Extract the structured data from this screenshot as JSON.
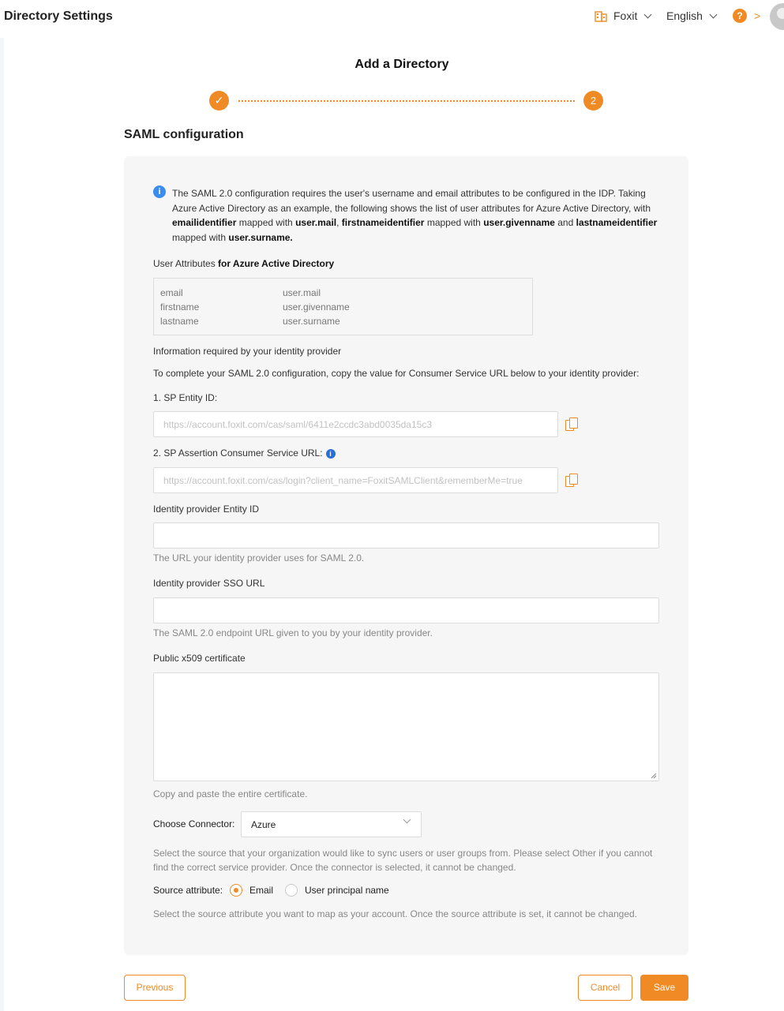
{
  "header": {
    "title": "Directory Settings",
    "org_name": "Foxit",
    "language": "English",
    "help_icon": "question-circle-icon",
    "help_label": "?",
    "arrow": ">"
  },
  "page": {
    "title": "Add a Directory",
    "steps": {
      "done_mark": "✓",
      "current": "2"
    },
    "section_title": "SAML configuration"
  },
  "info": {
    "icon_glyph": "i",
    "parts": [
      "The SAML 2.0 configuration requires the user's username and email attributes to be configured in the IDP. Taking Azure Active Directory as an example, the following shows the list of user attributes for Azure Active Directory, with ",
      "emailidentifier",
      " mapped with ",
      "user.mail",
      ", ",
      "firstnameidentifier",
      " mapped with ",
      "user.givenname",
      " and ",
      "lastnameidentifier",
      " mapped with ",
      "user.surname."
    ]
  },
  "attributes": {
    "heading_prefix": "User Attributes",
    "heading_bold": " for Azure Active Directory",
    "rows": [
      {
        "name": "email",
        "value": "user.mail"
      },
      {
        "name": "firstname",
        "value": "user.givenname"
      },
      {
        "name": "lastname",
        "value": "user.surname"
      }
    ]
  },
  "idp_info": {
    "heading": "Information required by your identity provider",
    "instruction": "To complete your SAML 2.0 configuration, copy the value for Consumer Service URL below to your identity provider:"
  },
  "sp_entity": {
    "label": "1. SP Entity ID:",
    "value": "https://account.foxit.com/cas/saml/6411e2ccdc3abd0035da15c3"
  },
  "sp_acs": {
    "label": "2. SP Assertion Consumer Service URL:",
    "info_glyph": "i",
    "value": "https://account.foxit.com/cas/login?client_name=FoxitSAMLClient&rememberMe=true"
  },
  "idp_entity": {
    "label": "Identity provider Entity ID",
    "value": "",
    "hint": "The URL your identity provider uses for SAML 2.0."
  },
  "idp_sso": {
    "label": "Identity provider SSO URL",
    "value": "",
    "hint": "The SAML 2.0 endpoint URL given to you by your identity provider."
  },
  "certificate": {
    "label": "Public x509 certificate",
    "value": "",
    "hint": "Copy and paste the entire certificate."
  },
  "connector": {
    "label": "Choose Connector:",
    "selected": "Azure",
    "hint_line1": "Select the source that your organization would like to sync users or user groups from. Please select Other if you cannot",
    "hint_line2": "find the correct service provider. Once the connector is selected, it cannot be changed."
  },
  "source_attribute": {
    "label": "Source attribute:",
    "options": [
      {
        "label": "Email",
        "selected": true
      },
      {
        "label": "User principal name",
        "selected": false
      }
    ],
    "hint": "Select the source attribute you want to map as your account. Once the source attribute is set, it cannot be changed."
  },
  "buttons": {
    "previous": "Previous",
    "cancel": "Cancel",
    "save": "Save"
  },
  "colors": {
    "accent": "#f08a24",
    "info_blue": "#3b8cf0"
  }
}
